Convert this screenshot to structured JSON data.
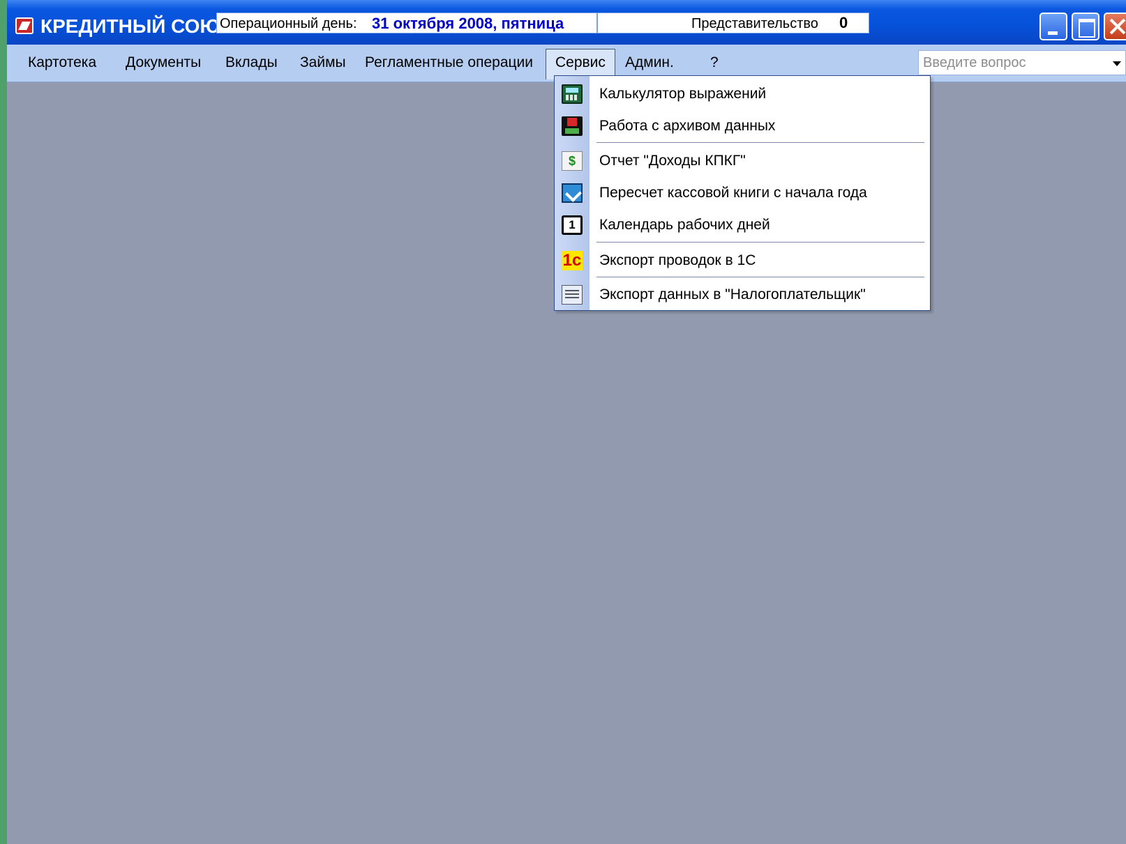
{
  "window": {
    "app_title": "КРЕДИТНЫЙ СОЮЗ",
    "operational_day_label": "Операционный день:",
    "operational_day_value": "31 октября 2008, пятница",
    "branch_label": "Представительство",
    "branch_value": "0"
  },
  "menubar": {
    "items": [
      {
        "label": "Картотека"
      },
      {
        "label": "Документы"
      },
      {
        "label": "Вклады"
      },
      {
        "label": "Займы"
      },
      {
        "label": "Регламентные операции"
      },
      {
        "label": "Сервис",
        "active": true
      },
      {
        "label": "Админ."
      },
      {
        "label": "?"
      }
    ],
    "help_placeholder": "Введите вопрос"
  },
  "service_menu": {
    "items": [
      {
        "label": "Калькулятор выражений",
        "icon": "calculator-icon"
      },
      {
        "label": "Работа с архивом данных",
        "icon": "archive-disk-icon"
      },
      {
        "label": "Отчет \"Доходы КПКГ\"",
        "icon": "dollar-report-icon"
      },
      {
        "label": "Пересчет кассовой книги с начала года",
        "icon": "cash-book-icon"
      },
      {
        "label": "Календарь рабочих дней",
        "icon": "calendar-icon"
      },
      {
        "label": "Экспорт проводок в 1С",
        "icon": "1c-icon"
      },
      {
        "label": "Экспорт данных в \"Налогоплательщик\"",
        "icon": "taxpayer-export-icon"
      }
    ],
    "icon_glyphs": {
      "dollar": "$",
      "calendar": "1",
      "one_c": "1c"
    }
  }
}
